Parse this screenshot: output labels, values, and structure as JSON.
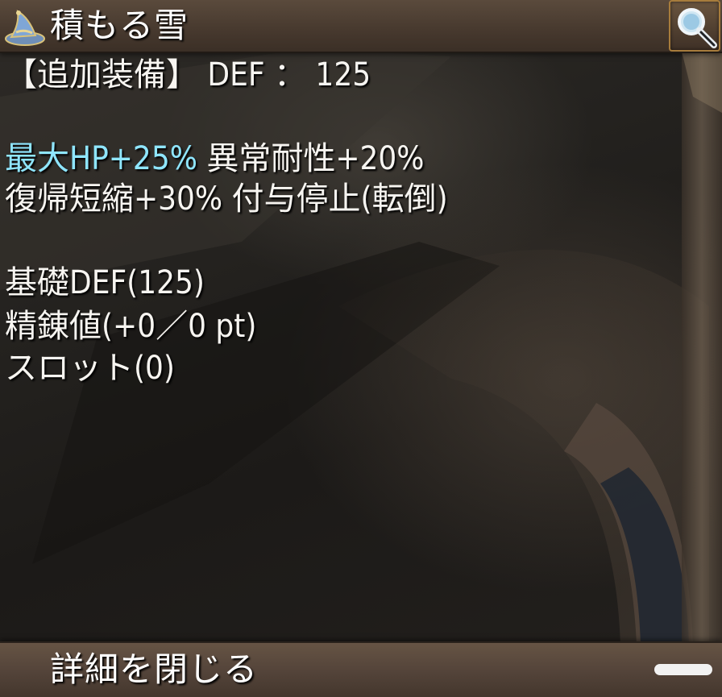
{
  "item": {
    "name": "積もる雪",
    "icon": "wizard-hat-icon"
  },
  "header": {
    "magnify_icon": "magnifying-glass-icon"
  },
  "stats": {
    "additional_equipment": "【追加装備】 DEF ： 125",
    "effect_line1_highlight": "最大HP+25%",
    "effect_line1_rest": " 異常耐性+20%",
    "effect_line2": "復帰短縮+30% 付与停止(転倒)",
    "base_def": "基礎DEF(125)",
    "refine_value": "精錬値(+0／0 pt)",
    "slots": "スロット(0)"
  },
  "footer": {
    "close_label": "詳細を閉じる"
  },
  "colors": {
    "highlight": "#8fe6ff",
    "text": "#f7f5f1",
    "bar": "#54443a",
    "accent_border": "#a77c3c"
  }
}
